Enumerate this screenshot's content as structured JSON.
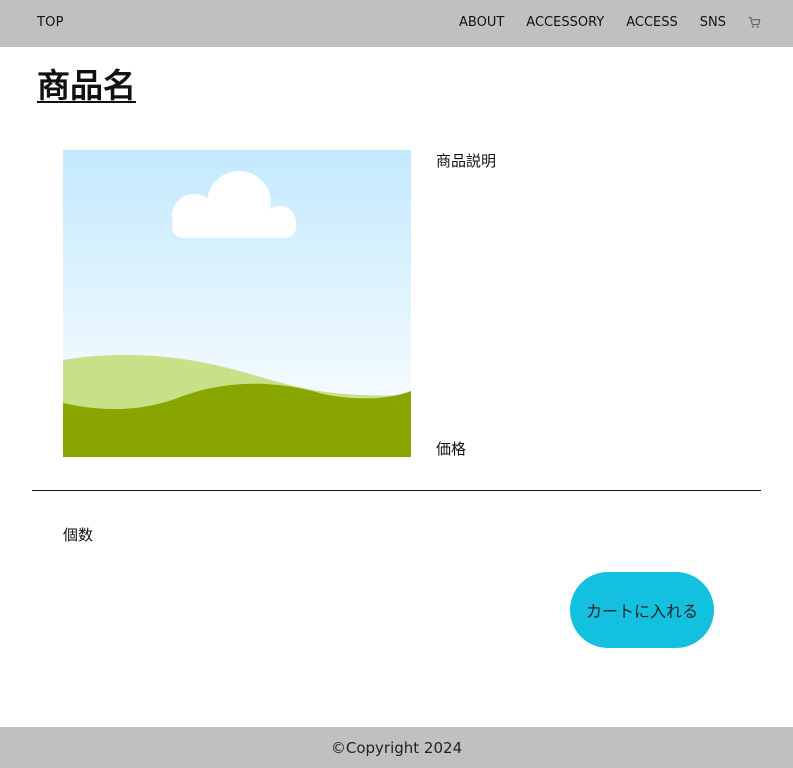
{
  "header": {
    "logo_label": "TOP",
    "nav": [
      {
        "label": "ABOUT"
      },
      {
        "label": "ACCESSORY"
      },
      {
        "label": "ACCESS"
      },
      {
        "label": "SNS"
      }
    ],
    "cart_icon": "cart-icon",
    "background_color": "#c0c0c0"
  },
  "product": {
    "title": "商品名",
    "image_icon": "landscape-image-placeholder",
    "description_label": "商品説明",
    "price_label": "価格",
    "quantity_label": "個数",
    "add_to_cart_label": "カートに入れる",
    "button_color": "#13c0e0"
  },
  "footer": {
    "copyright": "©Copyright 2024",
    "background_color": "#c0c0c0"
  }
}
